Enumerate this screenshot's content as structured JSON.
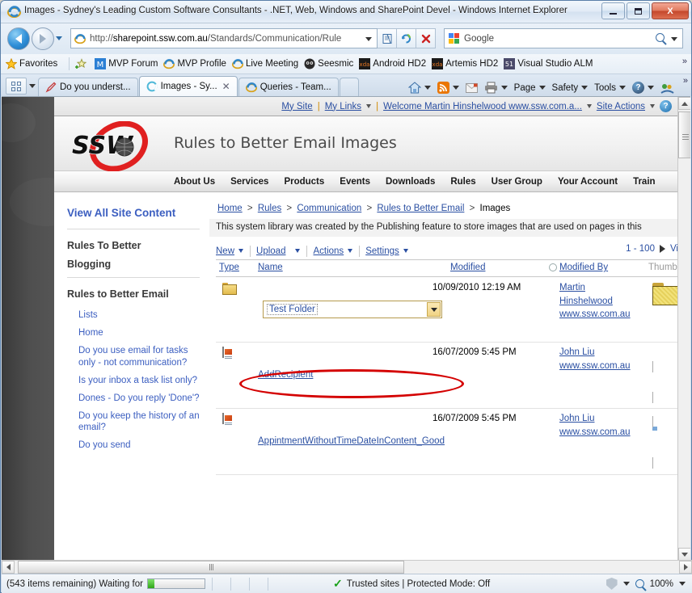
{
  "window": {
    "title": "Images - Sydney's Leading Custom Software Consultants - .NET, Web, Windows and SharePoint Devel - Windows Internet Explorer",
    "minimize_label": "Minimize",
    "maximize_label": "Maximize",
    "close_label": "X"
  },
  "address": {
    "url_host": "sharepoint.ssw.com.au",
    "url_prefix": "http://",
    "url_path": "/Standards/Communication/Rule",
    "refresh_label": "↻",
    "stop_label": "X",
    "compat_label": "Compatibility View"
  },
  "search": {
    "placeholder": "Google",
    "value": "Google"
  },
  "favorites": {
    "button_label": "Favorites",
    "items": [
      {
        "label": "MVP Forum",
        "icon": "mvp-icon"
      },
      {
        "label": "MVP Profile",
        "icon": "ie-icon"
      },
      {
        "label": "Live Meeting",
        "icon": "ie-icon"
      },
      {
        "label": "Seesmic",
        "icon": "seesmic-icon"
      },
      {
        "label": "Android HD2",
        "icon": "xda-icon"
      },
      {
        "label": "Artemis HD2",
        "icon": "xda-icon"
      },
      {
        "label": "Visual Studio ALM",
        "icon": "vs-icon"
      }
    ],
    "overflow_label": "»"
  },
  "tabs": {
    "items": [
      {
        "label": "Do you underst...",
        "active": false,
        "icon": "feed-pen-icon"
      },
      {
        "label": "Images - Sy...",
        "active": true,
        "icon": "loading-icon",
        "close_label": "✕"
      },
      {
        "label": "Queries - Team...",
        "active": false,
        "icon": "ie-icon"
      }
    ],
    "newtab_label": ""
  },
  "command_bar": {
    "home_label": "Home",
    "feeds_label": "Feeds",
    "mail_label": "Read mail",
    "print_label": "Print",
    "items": [
      {
        "label": "Page"
      },
      {
        "label": "Safety"
      },
      {
        "label": "Tools"
      }
    ],
    "help_label": "?",
    "messenger_label": "Messenger",
    "overflow_label": "»"
  },
  "sharepoint": {
    "global_links": [
      {
        "label": "My Site",
        "type": "link"
      },
      {
        "label": "|",
        "type": "sep"
      },
      {
        "label": "My Links",
        "type": "menu"
      },
      {
        "label": "|",
        "type": "sep"
      },
      {
        "label": "Welcome Martin Hinshelwood www.ssw.com.a...",
        "type": "menu"
      },
      {
        "label": "Site Actions",
        "type": "menu"
      }
    ],
    "help_label": "?"
  },
  "site_header": {
    "logo_text": "SSW",
    "page_title": "Rules to Better Email Images",
    "nav": [
      "About Us",
      "Services",
      "Products",
      "Events",
      "Downloads",
      "Rules",
      "User Group",
      "Your Account",
      "Train"
    ]
  },
  "left_nav": {
    "view_all_label": "View All Site Content",
    "group1_title_line1": "Rules To Better",
    "group1_title_line2": "Blogging",
    "group2_title": "Rules to Better Email",
    "links": [
      "Lists",
      "Home",
      "Do you use email for tasks only - not communication?",
      "Is your inbox a task list only?",
      "Dones - Do you reply 'Done'?",
      "Do you keep the history of an email?",
      "Do you send"
    ]
  },
  "library": {
    "breadcrumb": [
      {
        "label": "Home",
        "link": true
      },
      {
        "label": "Rules",
        "link": true
      },
      {
        "label": "Communication",
        "link": true
      },
      {
        "label": "Rules to Better Email",
        "link": true
      },
      {
        "label": "Images",
        "link": false
      }
    ],
    "breadcrumb_separator": ">",
    "description": "This system library was created by the Publishing feature to store images that are used on pages in this",
    "toolbar": [
      {
        "label": "New",
        "has_menu": true
      },
      {
        "label": "Upload",
        "has_menu": true
      },
      {
        "label": "Actions",
        "has_menu": true
      },
      {
        "label": "Settings",
        "has_menu": true
      }
    ],
    "paging_label": "1 - 100",
    "view_label": "Vi",
    "columns": {
      "type": "Type",
      "name": "Name",
      "modified": "Modified",
      "modified_by": "Modified By",
      "thumbnail": "Thumbna"
    },
    "rows": [
      {
        "icon": "folder-icon",
        "name": "",
        "editing": true,
        "edit_value": "Test Folder",
        "modified": "10/09/2010 12:19 AM",
        "modified_by_line1": "Martin",
        "modified_by_line2": "Hinshelwood",
        "modified_by_line3": "www.ssw.com.au",
        "thumbnail": "folder-thumb"
      },
      {
        "icon": "image-doc-icon",
        "name": "AddRecipient",
        "editing": false,
        "modified": "16/07/2009 5:45 PM",
        "modified_by_line1": "John Liu",
        "modified_by_line2": "www.ssw.com.au",
        "modified_by_line3": "",
        "thumbnail": "doc-thumb"
      },
      {
        "icon": "image-doc-icon",
        "name": "AppintmentWithoutTimeDateInContent_Good",
        "editing": false,
        "modified": "16/07/2009 5:45 PM",
        "modified_by_line1": "John Liu",
        "modified_by_line2": "www.ssw.com.au",
        "modified_by_line3": "",
        "thumbnail": "doc-thumb2"
      }
    ]
  },
  "annotation": {
    "shape": "ellipse",
    "color": "#d40000",
    "target": "folder-name-edit-field"
  },
  "status_bar": {
    "message": "(543 items remaining) Waiting for",
    "progress_percent": 12,
    "zone_text": "Trusted sites | Protected Mode: Off",
    "zoom_level": "100%"
  }
}
